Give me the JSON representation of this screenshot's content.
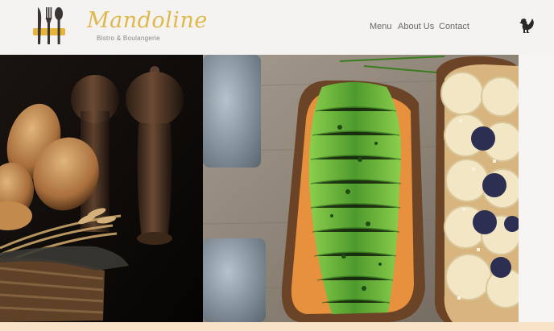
{
  "brand": {
    "name": "Mandoline",
    "tagline": "Bistro & Boulangerie",
    "accent_color": "#e0b84a"
  },
  "nav": {
    "items": [
      {
        "label": "Menu"
      },
      {
        "label": "About Us"
      },
      {
        "label": "Contact"
      }
    ]
  },
  "icons": {
    "logo": "fork-knife-spoon-icon",
    "corner": "rooster-icon"
  },
  "hero": {
    "left_image": "bread-basket-and-pepper-mills-photo",
    "right_image": "avocado-and-banana-toast-photo"
  }
}
